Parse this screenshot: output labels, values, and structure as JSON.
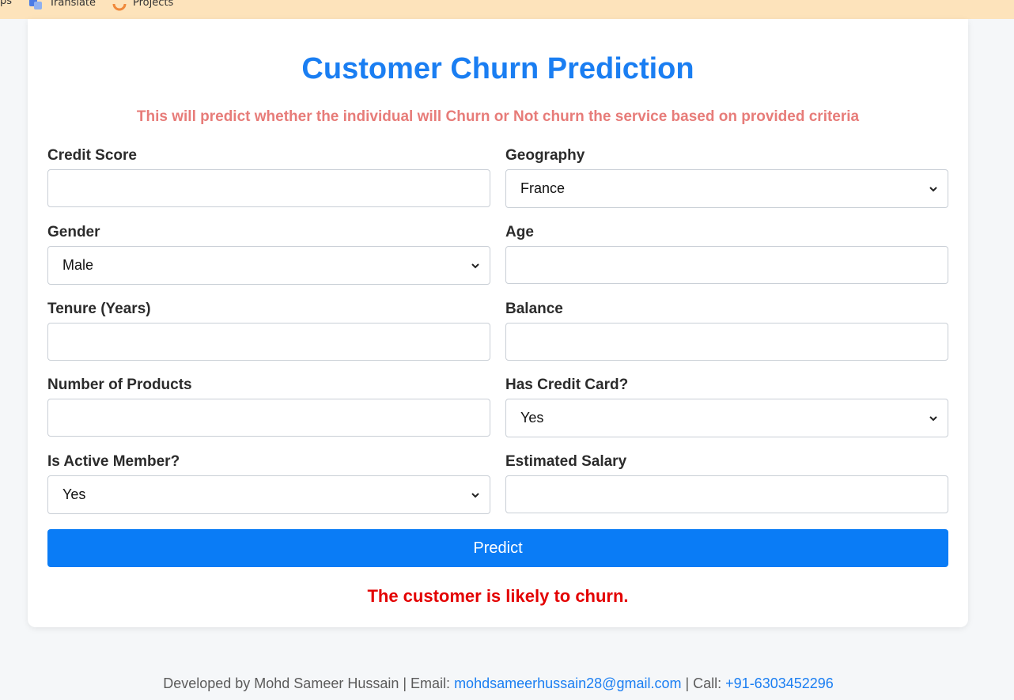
{
  "bookmarks": [
    {
      "label": "ps"
    },
    {
      "label": "Translate"
    },
    {
      "label": "Projects"
    }
  ],
  "form": {
    "title": "Customer Churn Prediction",
    "subtitle": "This will predict whether the individual will Churn or Not churn the service based on provided criteria",
    "fields": {
      "credit_score": {
        "label": "Credit Score",
        "value": ""
      },
      "geography": {
        "label": "Geography",
        "value": "France"
      },
      "gender": {
        "label": "Gender",
        "value": "Male"
      },
      "age": {
        "label": "Age",
        "value": ""
      },
      "tenure": {
        "label": "Tenure (Years)",
        "value": ""
      },
      "balance": {
        "label": "Balance",
        "value": ""
      },
      "num_products": {
        "label": "Number of Products",
        "value": ""
      },
      "has_credit_card": {
        "label": "Has Credit Card?",
        "value": "Yes"
      },
      "is_active_member": {
        "label": "Is Active Member?",
        "value": "Yes"
      },
      "estimated_salary": {
        "label": "Estimated Salary",
        "value": ""
      }
    },
    "predict_label": "Predict",
    "result_text": "The customer is likely to churn."
  },
  "footer": {
    "developed_by": "Developed by Mohd Sameer Hussain | Email: ",
    "email": "mohdsameerhussain28@gmail.com",
    "call_prefix": " | Call: ",
    "phone": "+91-6303452296"
  },
  "colors": {
    "title": "#1a7ef2",
    "subtitle": "#e77c79",
    "button": "#0a7cf6",
    "result": "#e30000",
    "bookmarks_bar": "#fde3bb"
  }
}
